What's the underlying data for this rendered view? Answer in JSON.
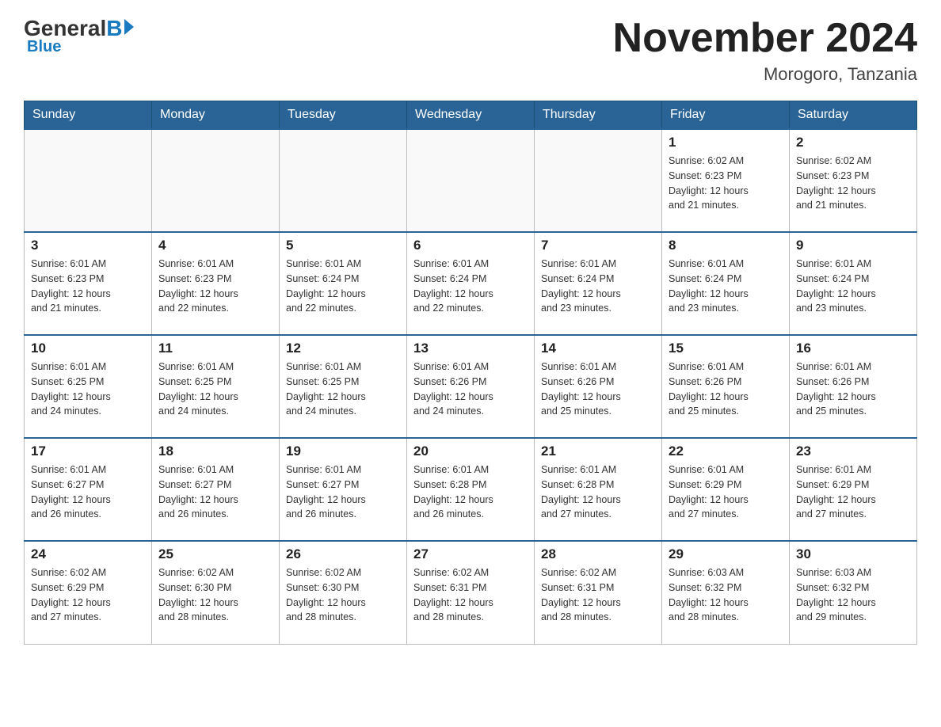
{
  "header": {
    "logo": {
      "general": "General",
      "blue": "Blue"
    },
    "title": "November 2024",
    "location": "Morogoro, Tanzania"
  },
  "weekdays": [
    "Sunday",
    "Monday",
    "Tuesday",
    "Wednesday",
    "Thursday",
    "Friday",
    "Saturday"
  ],
  "weeks": [
    [
      {
        "day": "",
        "info": ""
      },
      {
        "day": "",
        "info": ""
      },
      {
        "day": "",
        "info": ""
      },
      {
        "day": "",
        "info": ""
      },
      {
        "day": "",
        "info": ""
      },
      {
        "day": "1",
        "info": "Sunrise: 6:02 AM\nSunset: 6:23 PM\nDaylight: 12 hours\nand 21 minutes."
      },
      {
        "day": "2",
        "info": "Sunrise: 6:02 AM\nSunset: 6:23 PM\nDaylight: 12 hours\nand 21 minutes."
      }
    ],
    [
      {
        "day": "3",
        "info": "Sunrise: 6:01 AM\nSunset: 6:23 PM\nDaylight: 12 hours\nand 21 minutes."
      },
      {
        "day": "4",
        "info": "Sunrise: 6:01 AM\nSunset: 6:23 PM\nDaylight: 12 hours\nand 22 minutes."
      },
      {
        "day": "5",
        "info": "Sunrise: 6:01 AM\nSunset: 6:24 PM\nDaylight: 12 hours\nand 22 minutes."
      },
      {
        "day": "6",
        "info": "Sunrise: 6:01 AM\nSunset: 6:24 PM\nDaylight: 12 hours\nand 22 minutes."
      },
      {
        "day": "7",
        "info": "Sunrise: 6:01 AM\nSunset: 6:24 PM\nDaylight: 12 hours\nand 23 minutes."
      },
      {
        "day": "8",
        "info": "Sunrise: 6:01 AM\nSunset: 6:24 PM\nDaylight: 12 hours\nand 23 minutes."
      },
      {
        "day": "9",
        "info": "Sunrise: 6:01 AM\nSunset: 6:24 PM\nDaylight: 12 hours\nand 23 minutes."
      }
    ],
    [
      {
        "day": "10",
        "info": "Sunrise: 6:01 AM\nSunset: 6:25 PM\nDaylight: 12 hours\nand 24 minutes."
      },
      {
        "day": "11",
        "info": "Sunrise: 6:01 AM\nSunset: 6:25 PM\nDaylight: 12 hours\nand 24 minutes."
      },
      {
        "day": "12",
        "info": "Sunrise: 6:01 AM\nSunset: 6:25 PM\nDaylight: 12 hours\nand 24 minutes."
      },
      {
        "day": "13",
        "info": "Sunrise: 6:01 AM\nSunset: 6:26 PM\nDaylight: 12 hours\nand 24 minutes."
      },
      {
        "day": "14",
        "info": "Sunrise: 6:01 AM\nSunset: 6:26 PM\nDaylight: 12 hours\nand 25 minutes."
      },
      {
        "day": "15",
        "info": "Sunrise: 6:01 AM\nSunset: 6:26 PM\nDaylight: 12 hours\nand 25 minutes."
      },
      {
        "day": "16",
        "info": "Sunrise: 6:01 AM\nSunset: 6:26 PM\nDaylight: 12 hours\nand 25 minutes."
      }
    ],
    [
      {
        "day": "17",
        "info": "Sunrise: 6:01 AM\nSunset: 6:27 PM\nDaylight: 12 hours\nand 26 minutes."
      },
      {
        "day": "18",
        "info": "Sunrise: 6:01 AM\nSunset: 6:27 PM\nDaylight: 12 hours\nand 26 minutes."
      },
      {
        "day": "19",
        "info": "Sunrise: 6:01 AM\nSunset: 6:27 PM\nDaylight: 12 hours\nand 26 minutes."
      },
      {
        "day": "20",
        "info": "Sunrise: 6:01 AM\nSunset: 6:28 PM\nDaylight: 12 hours\nand 26 minutes."
      },
      {
        "day": "21",
        "info": "Sunrise: 6:01 AM\nSunset: 6:28 PM\nDaylight: 12 hours\nand 27 minutes."
      },
      {
        "day": "22",
        "info": "Sunrise: 6:01 AM\nSunset: 6:29 PM\nDaylight: 12 hours\nand 27 minutes."
      },
      {
        "day": "23",
        "info": "Sunrise: 6:01 AM\nSunset: 6:29 PM\nDaylight: 12 hours\nand 27 minutes."
      }
    ],
    [
      {
        "day": "24",
        "info": "Sunrise: 6:02 AM\nSunset: 6:29 PM\nDaylight: 12 hours\nand 27 minutes."
      },
      {
        "day": "25",
        "info": "Sunrise: 6:02 AM\nSunset: 6:30 PM\nDaylight: 12 hours\nand 28 minutes."
      },
      {
        "day": "26",
        "info": "Sunrise: 6:02 AM\nSunset: 6:30 PM\nDaylight: 12 hours\nand 28 minutes."
      },
      {
        "day": "27",
        "info": "Sunrise: 6:02 AM\nSunset: 6:31 PM\nDaylight: 12 hours\nand 28 minutes."
      },
      {
        "day": "28",
        "info": "Sunrise: 6:02 AM\nSunset: 6:31 PM\nDaylight: 12 hours\nand 28 minutes."
      },
      {
        "day": "29",
        "info": "Sunrise: 6:03 AM\nSunset: 6:32 PM\nDaylight: 12 hours\nand 28 minutes."
      },
      {
        "day": "30",
        "info": "Sunrise: 6:03 AM\nSunset: 6:32 PM\nDaylight: 12 hours\nand 29 minutes."
      }
    ]
  ]
}
